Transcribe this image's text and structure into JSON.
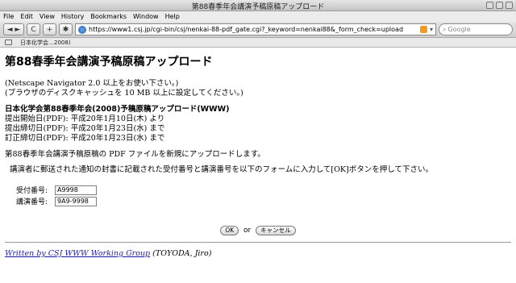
{
  "window": {
    "title": "第88春季年会講演予稿原稿アップロード"
  },
  "menu": [
    "File",
    "Edit",
    "View",
    "History",
    "Bookmarks",
    "Window",
    "Help"
  ],
  "toolbar": {
    "back_glyph": "◄ ►",
    "reload_glyph": "C",
    "add_glyph": "+",
    "url": "https://www1.csj.jp/cgi-bin/csj/nenkai-88-pdf_gate.cgi?_keyword=nenkai88&_form_check=upload",
    "search_placeholder": "Google"
  },
  "bookmarks": {
    "tab_label": "日本化学会…2008)"
  },
  "page": {
    "heading": "第88春季年会講演予稿原稿アップロード",
    "browser_note_1": "(Netscape Navigator 2.0 以上をお使い下さい。)",
    "browser_note_2": "(ブラウザのディスクキャッシュを 10 MB 以上に設定してください。)",
    "schedule_title": "日本化学会第88春季年会(2008)予稿原稿アップロード(WWW)",
    "schedule_start": "提出開始日(PDF): 平成20年1月10日(木) より",
    "schedule_end": "提出締切日(PDF): 平成20年1月23日(水) まで",
    "schedule_fix": "訂正締切日(PDF): 平成20年1月23日(水) まで",
    "description": "第88春季年会講演予稿原稿の PDF ファイルを新規にアップロードします。",
    "instruction": "講演者に郵送された通知の封書に記載された受付番号と講演番号を以下のフォームに入力して[OK]ボタンを押して下さい。",
    "form": {
      "receipt_label": "受付番号:",
      "receipt_value": "A9998",
      "lecture_label": "講演番号:",
      "lecture_value": "9A9-9998"
    },
    "ok_label": "OK",
    "or_label": "or",
    "cancel_label": "キャンセル",
    "footer_link": "Written by CSJ WWW Working Group",
    "footer_author": " (TOYODA, Jiro)"
  }
}
